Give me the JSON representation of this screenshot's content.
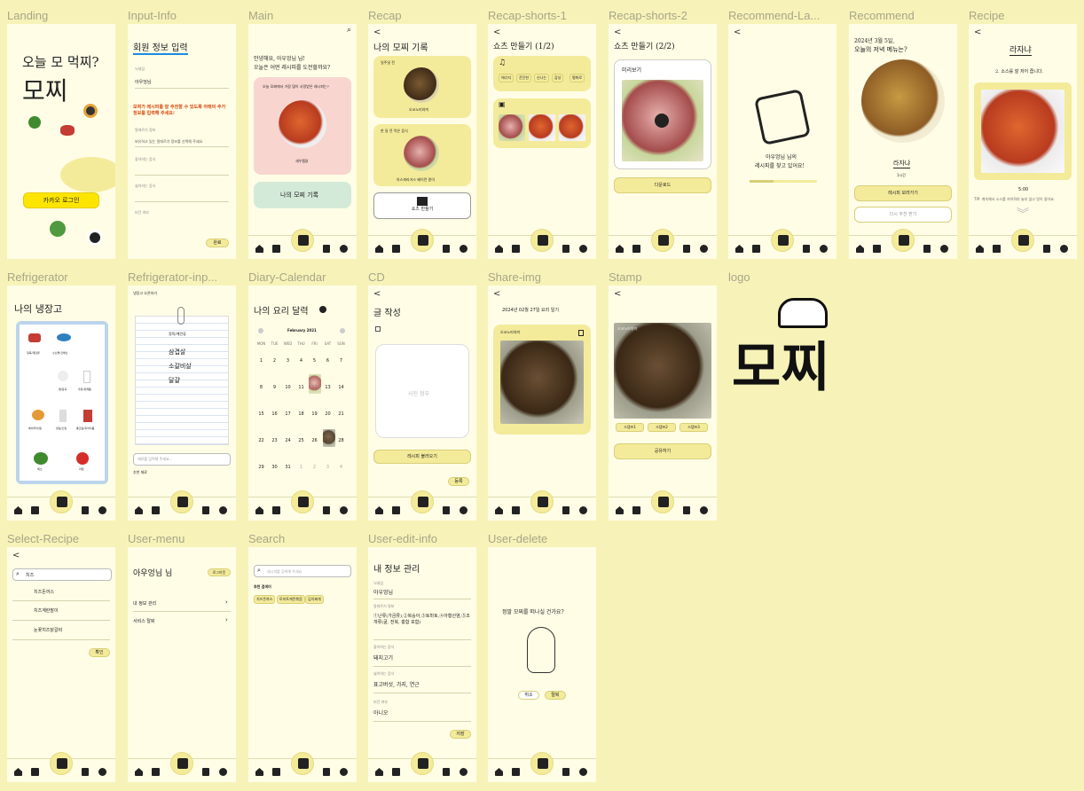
{
  "frames": {
    "landing": "Landing",
    "input_info": "Input-Info",
    "main": "Main",
    "recap": "Recap",
    "recap_shorts_1": "Recap-shorts-1",
    "recap_shorts_2": "Recap-shorts-2",
    "recommend_la": "Recommend-La...",
    "recommend": "Recommend",
    "recipe": "Recipe",
    "refrigerator": "Refrigerator",
    "refrigerator_inp": "Refrigerator-inp...",
    "diary_calendar": "Diary-Calendar",
    "cd": "CD",
    "share_img": "Share-img",
    "stamp": "Stamp",
    "logo": "logo",
    "select_recipe": "Select-Recipe",
    "user_menu": "User-menu",
    "search": "Search",
    "user_edit_info": "User-edit-info",
    "user_delete": "User-delete"
  },
  "landing": {
    "title_line": "오늘 모 먹찌?",
    "big": "모찌",
    "kakao": "카카오 로그인"
  },
  "input_info": {
    "title": "회원 정보 입력",
    "nick_label": "닉네임",
    "nick_value": "아우엉님",
    "notice": "모찌가 레시피를 잘 추천할 수 있도록 아래의 추가 정보를 입력해 주세요!",
    "allergy_label": "알레르기 정보",
    "allergy_ph": "보유하고 있는 알레르기 정보를 선택해 주세요",
    "like_label": "좋아하는 음식",
    "dislike_label": "싫어하는 음식",
    "vegan_label": "비건 여부",
    "done": "완료"
  },
  "main": {
    "greet1": "안녕해요, 아우엉님 님!",
    "greet2": "오늘은 어떤 레시피를 도전할까요?",
    "card_q": "오늘 모찌에서 가장 많이 사랑받은 레시피는?",
    "dish": "새우찜닭",
    "diary_btn": "나의 모찌 기록"
  },
  "recap": {
    "title": "나의 모찌 기록",
    "c1_label": "일주일 전",
    "c1_dish": "오코노미야끼",
    "c2_label": "한 달 전 먹은 음식",
    "c2_dish": "아스파라거스 베이컨 말이",
    "shorts": "쇼츠 만들기"
  },
  "recap_shorts_1": {
    "title": "쇼츠 만들기 (1/2)",
    "tags": [
      "에너지",
      "잔잔한",
      "신나는",
      "감성",
      "평화로"
    ]
  },
  "recap_shorts_2": {
    "title": "쇼츠 만들기 (2/2)",
    "preview": "미리보기",
    "download": "다운로드"
  },
  "recommend_la": {
    "line1": "아우엉님 님의",
    "line2": "레시피를 찾고 있어요!"
  },
  "recommend": {
    "date": "2024년 3월 5일,",
    "q": "오늘의 저녁 메뉴는?",
    "dish": "라자냐",
    "time": "1시간",
    "see": "레시피 보러가기",
    "other": "다시 추천 받기"
  },
  "recipe": {
    "title": "라자냐",
    "step": "2. 소스를 잘 저어 줍니다.",
    "timer": "5:00",
    "tip": "TIP: 계속해서 소스를 저어줘야 눌지 않고 맛이 좋아요."
  },
  "refrigerator": {
    "title": "나의 냉장고",
    "items": [
      "정육/계란류",
      "수산물/건해산",
      "쌀/잡곡",
      "우유/유제품",
      "베이커리/잼",
      "양념/오일",
      "통조림/즉석식품",
      "채소",
      "과일"
    ]
  },
  "refrigerator_inp": {
    "back": "냉장고 오픈하기",
    "category": "정육/계란류",
    "items": [
      "삼겹살",
      "소갈비살",
      "달걀"
    ],
    "input_ph": "재료를 입력해 주세요...",
    "recent": "추천 재료"
  },
  "diary_calendar": {
    "title": "나의 요리 달력",
    "month": "February 2021",
    "days": [
      "MON",
      "TUE",
      "WED",
      "THU",
      "FRI",
      "SAT",
      "SUN"
    ],
    "weeks": [
      [
        "",
        "",
        "",
        "",
        "",
        "",
        ""
      ],
      [
        "1",
        "2",
        "3",
        "4",
        "5",
        "6",
        "7"
      ],
      [
        "8",
        "9",
        "10",
        "11",
        "12",
        "13",
        "14"
      ],
      [
        "15",
        "16",
        "17",
        "18",
        "19",
        "20",
        "21"
      ],
      [
        "22",
        "23",
        "24",
        "25",
        "26",
        "27",
        "28"
      ],
      [
        "29",
        "30",
        "31",
        "1",
        "2",
        "3",
        "4"
      ]
    ]
  },
  "cd": {
    "title": "글 작성",
    "photo": "사진 첨부",
    "load": "레시피 불러오기",
    "submit": "등록"
  },
  "share_img": {
    "date": "2024년 02월 27일 요리 일기",
    "dish": "오코노미야끼"
  },
  "stamp": {
    "dish": "오코노미야끼",
    "tags": [
      "스탬프1",
      "스탬프2",
      "스탬프3"
    ],
    "share": "공유하기"
  },
  "logo": {
    "text": "모찌"
  },
  "select_recipe": {
    "query": "치즈",
    "results": [
      "치즈돈까스",
      "치즈계란말이",
      "눈꽃치즈닭갈비"
    ],
    "ok": "확인"
  },
  "user_menu": {
    "name": "아우엉님 님",
    "logout": "로그아웃",
    "edit": "내 정보 관리",
    "leave": "서비스 탈퇴"
  },
  "search": {
    "ph": "레시피를 검색해 주세요",
    "rec": "추천 검색어",
    "tags": [
      "치즈돈까스",
      "토마토계란볶음",
      "김치찌개"
    ]
  },
  "user_edit_info": {
    "title": "내 정보 관리",
    "nick_label": "닉네임",
    "nick": "아우엉님",
    "allergy_label": "알레르기 정보",
    "allergy": "①난류(가금류),②복숭아,③토마토,④아황산염,⑤조개류(굴, 전복, 홍합 포함)",
    "like_label": "좋아하는 음식",
    "like": "돼지고기",
    "dislike_label": "싫어하는 음식",
    "dislike": "표고버섯, 가지, 연근",
    "vegan_label": "비건 여부",
    "vegan": "아니오",
    "save": "저장"
  },
  "user_delete": {
    "q": "정말 모찌를 떠나실 건가요?",
    "cancel": "취소",
    "leave": "탈퇴"
  }
}
